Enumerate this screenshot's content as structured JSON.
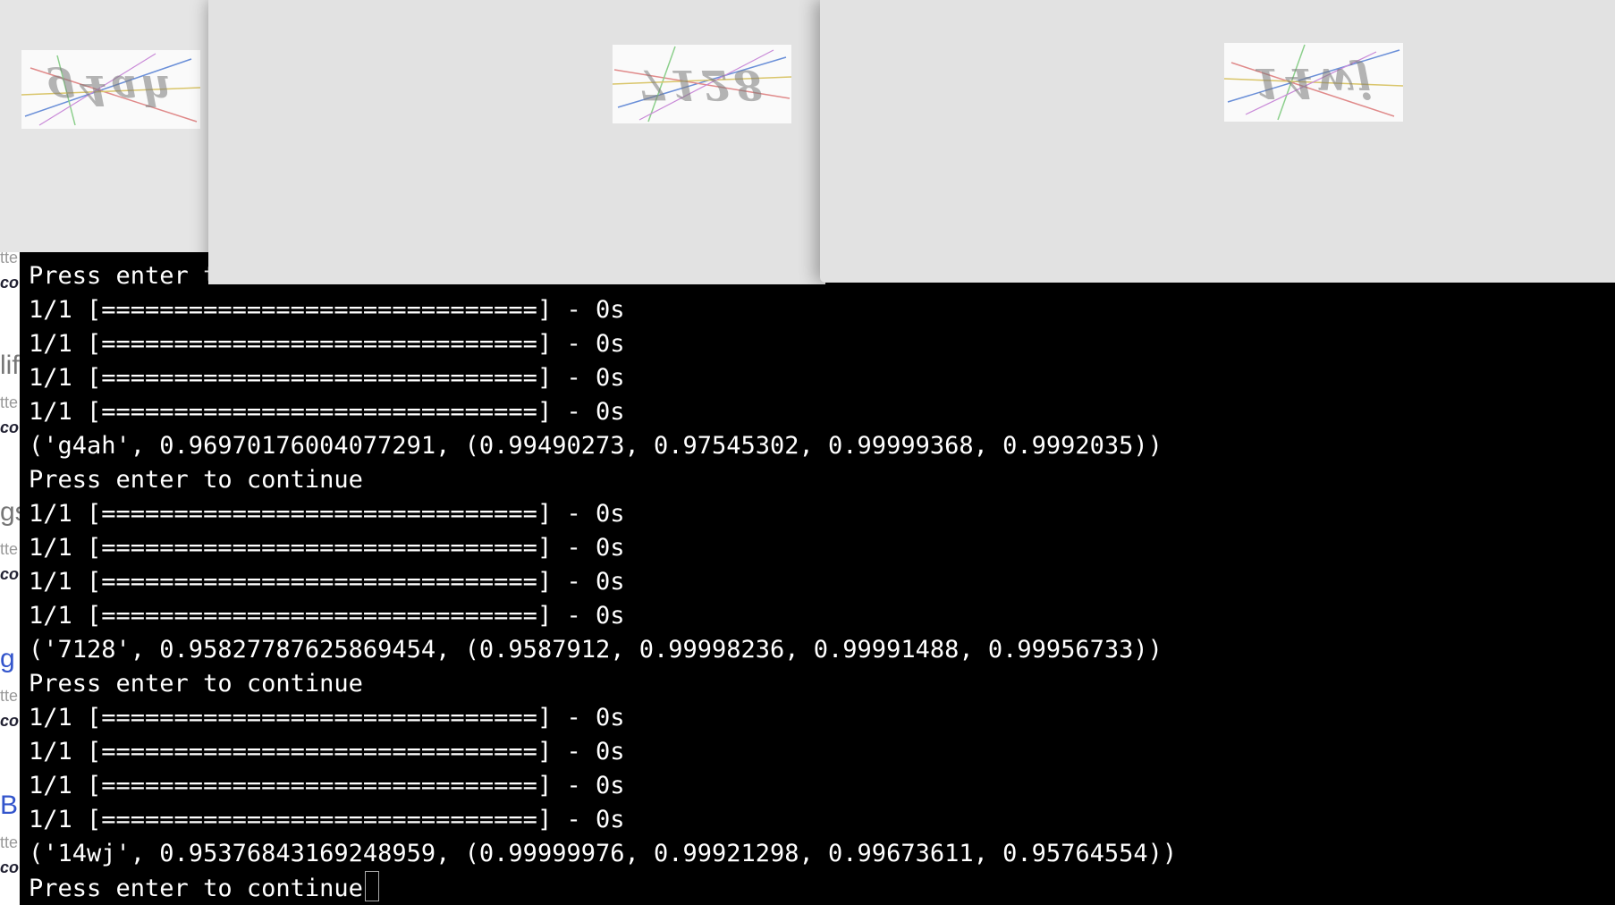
{
  "background_page": {
    "fragments": [
      "tte",
      "co",
      "lif",
      "tte",
      "co",
      "gs",
      "tte",
      "co",
      "g",
      "tte",
      "co",
      "Br",
      "tte",
      "co"
    ]
  },
  "captchas": [
    {
      "text": "g4ah"
    },
    {
      "text": "7128"
    },
    {
      "text": "14wj"
    }
  ],
  "terminal": {
    "lines": [
      "Press enter to continue",
      "1/1 [==============================] - 0s",
      "1/1 [==============================] - 0s",
      "1/1 [==============================] - 0s",
      "1/1 [==============================] - 0s",
      "('g4ah', 0.96970176004077291, (0.99490273, 0.97545302, 0.99999368, 0.9992035))",
      "Press enter to continue",
      "1/1 [==============================] - 0s",
      "1/1 [==============================] - 0s",
      "1/1 [==============================] - 0s",
      "1/1 [==============================] - 0s",
      "('7128', 0.95827787625869454, (0.9587912, 0.99998236, 0.99991488, 0.99956733))",
      "Press enter to continue",
      "1/1 [==============================] - 0s",
      "1/1 [==============================] - 0s",
      "1/1 [==============================] - 0s",
      "1/1 [==============================] - 0s",
      "('14wj', 0.95376843169248959, (0.99999976, 0.99921298, 0.99673611, 0.95764554))",
      "Press enter to continue"
    ]
  }
}
